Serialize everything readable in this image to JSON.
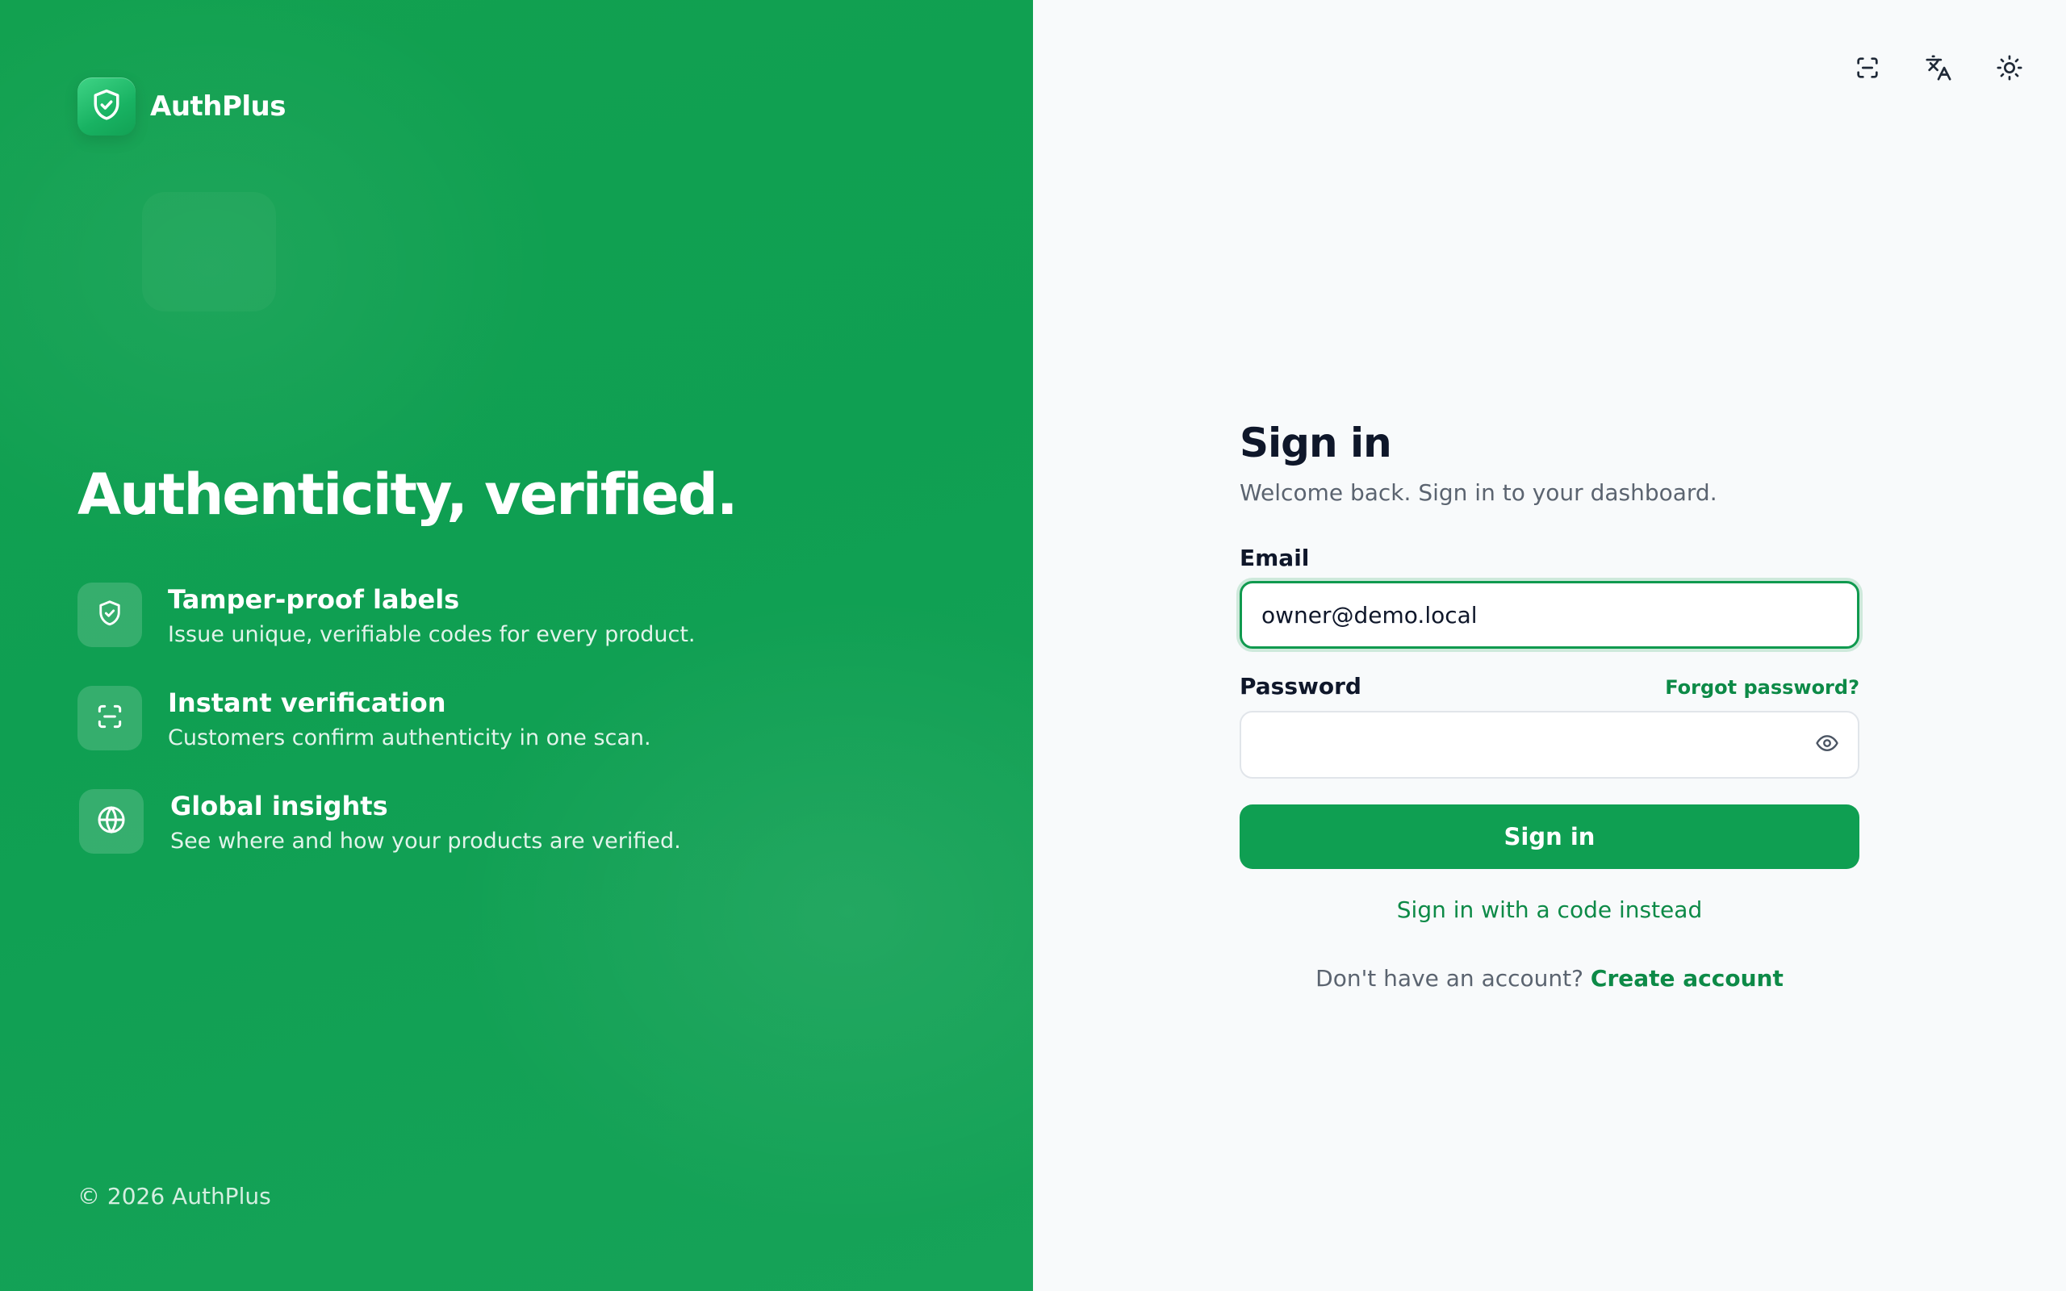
{
  "brand": {
    "name": "AuthPlus",
    "logo_icon": "shield-check-icon"
  },
  "hero": {
    "title": "Authenticity, verified.",
    "features": [
      {
        "icon": "shield-check-icon",
        "title": "Tamper-proof labels",
        "description": "Issue unique, verifiable codes for every product."
      },
      {
        "icon": "scan-icon",
        "title": "Instant verification",
        "description": "Customers confirm authenticity in one scan."
      },
      {
        "icon": "globe-icon",
        "title": "Global insights",
        "description": "See where and how your products are verified."
      }
    ]
  },
  "footer": {
    "copyright": "© 2026 AuthPlus"
  },
  "toolbar": {
    "icons": [
      "scan-icon",
      "translate-icon",
      "sun-icon"
    ]
  },
  "form": {
    "title": "Sign in",
    "subtitle": "Welcome back. Sign in to your dashboard.",
    "email": {
      "label": "Email",
      "value": "owner@demo.local"
    },
    "password": {
      "label": "Password",
      "value": "",
      "forgot_label": "Forgot password?"
    },
    "submit_label": "Sign in",
    "code_link_label": "Sign in with a code instead",
    "signup_prompt": "Don't have an account?",
    "signup_link_label": "Create account"
  },
  "colors": {
    "brand_green": "#0f9f52",
    "link_green": "#0d8a47",
    "heading_text": "#0f172a",
    "muted_text": "#5b6470",
    "panel_background": "#f8fafb"
  }
}
